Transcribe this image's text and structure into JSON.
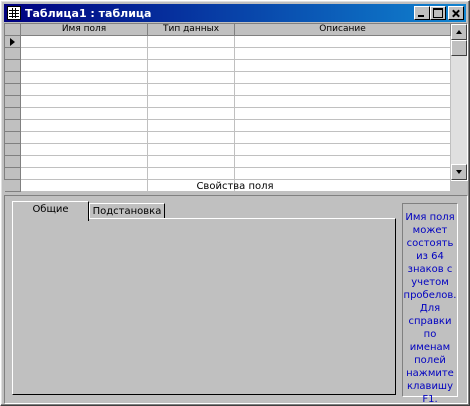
{
  "window": {
    "title": "Таблица1 : таблица"
  },
  "grid": {
    "columns": [
      "Имя поля",
      "Тип данных",
      "Описание"
    ],
    "row_count": 13,
    "current_row_index": 0
  },
  "field_properties": {
    "label": "Свойства поля",
    "tabs": [
      "Общие",
      "Подстановка"
    ],
    "active_tab": "Общие",
    "help_text": "Имя поля может состоять из 64 знаков с учетом пробелов. Для справки по именам полей нажмите клавишу F1."
  },
  "colors": {
    "titlebar_start": "#000080",
    "titlebar_end": "#1084d0",
    "help_text": "#0000c0",
    "face": "#c0c0c0"
  },
  "icons": {
    "app": "table-icon",
    "minimize": "minimize-icon",
    "maximize": "maximize-icon",
    "close": "close-icon",
    "row_selector": "current-row-arrow-icon",
    "scroll_up": "scroll-up-arrow-icon",
    "scroll_down": "scroll-down-arrow-icon"
  }
}
